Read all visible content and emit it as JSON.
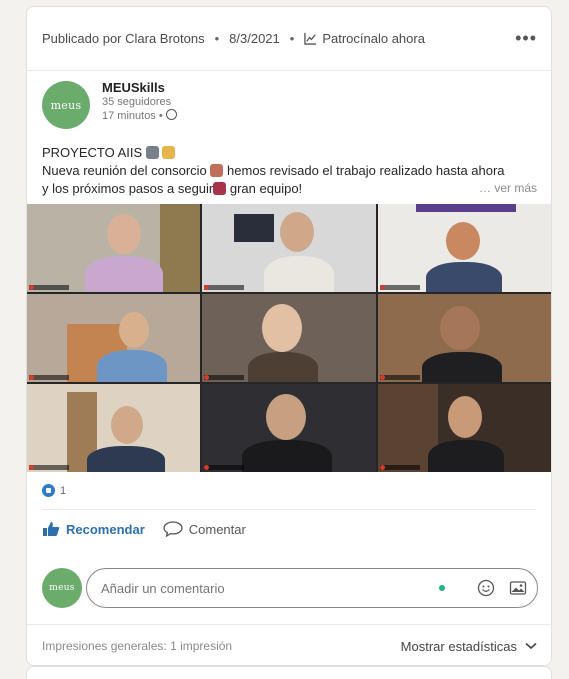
{
  "header": {
    "published_by": "Publicado por Clara Brotons",
    "date": "8/3/2021",
    "sponsor": "Patrocínalo ahora",
    "more": "•••"
  },
  "author": {
    "logo_text": "meus",
    "name": "MEUSkills",
    "followers": "35 seguidores",
    "time": "17 minutos •"
  },
  "post": {
    "line1": "PROYECTO AIIS",
    "line2_a": "Nueva reunión del consorcio",
    "line2_b": "hemos revisado el trabajo realizado hasta ahora",
    "line3_a": "y los próximos pasos a seguir",
    "line3_b": "gran equipo!",
    "see_more": "… ver más"
  },
  "reactions": {
    "count": "1"
  },
  "actions": {
    "recommend": "Recomendar",
    "comment": "Comentar"
  },
  "comment": {
    "placeholder": "Añadir un comentario"
  },
  "footer": {
    "impressions": "Impresiones generales: 1 impresión",
    "show_stats": "Mostrar estadísticas"
  },
  "icons": [
    "trend-icon",
    "globe-icon",
    "like-icon",
    "comment-icon",
    "emoji-icon",
    "image-icon",
    "chevron-down-icon"
  ],
  "colors": {
    "brand_green": "#6bab6b",
    "link_blue": "#2c6fad",
    "online": "#29b37a"
  }
}
